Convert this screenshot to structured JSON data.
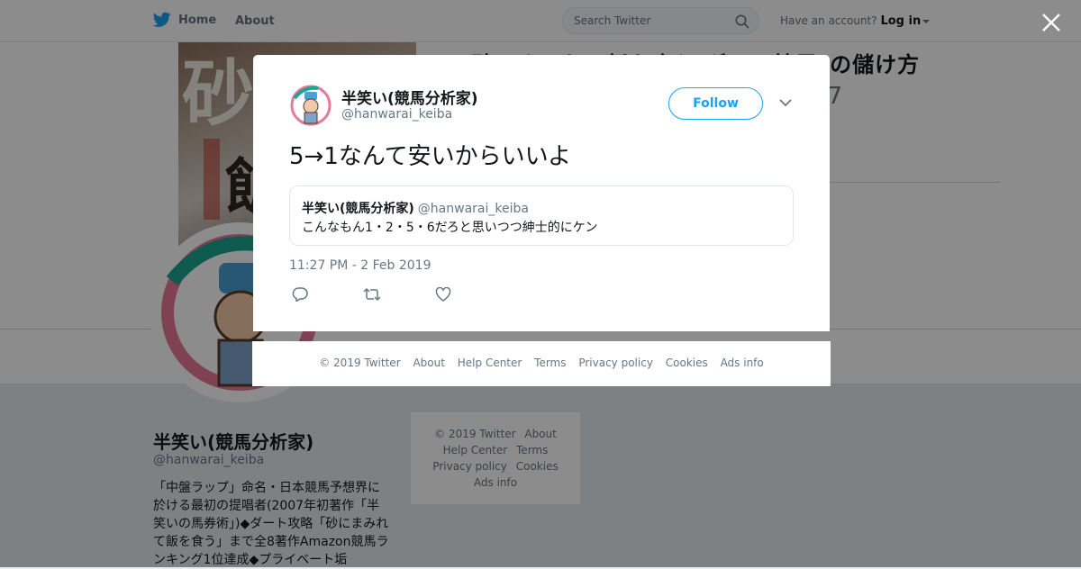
{
  "nav": {
    "home_label": "Home",
    "about_label": "About",
    "search_placeholder": "Search Twitter",
    "account_prompt": "Have an account?",
    "login_label": "Log in"
  },
  "background_profile": {
    "book_title": "砂にまみれて飯を食う ダート競馬\"の儲け方",
    "book_number": "17",
    "name": "半笑い(競馬分析家)",
    "handle": "@hanwarai_keiba",
    "bio": "「中盤ラップ」命名・日本競馬予想界に於ける最初の提唱者(2007年初著作「半笑いの馬券術」)◆ダート攻略「砂にまみれて飯を食う」まで全8著作Amazon競馬ランキング1位達成◆プライベート垢",
    "footer_links": [
      "© 2019 Twitter",
      "About",
      "Help Center",
      "Terms",
      "Privacy policy",
      "Cookies",
      "Ads info"
    ]
  },
  "tweet": {
    "author_name": "半笑い(競馬分析家)",
    "author_handle": "@hanwarai_keiba",
    "follow_label": "Follow",
    "text": "5→1なんて安いからいいよ",
    "quoted": {
      "author_name": "半笑い(競馬分析家)",
      "author_handle": "@hanwarai_keiba",
      "text": "こんなもん1・2・5・6だろと思いつつ紳士的にケン"
    },
    "timestamp": "11:27 PM - 2 Feb 2019"
  },
  "modal_footer": {
    "links": [
      "© 2019 Twitter",
      "About",
      "Help Center",
      "Terms",
      "Privacy policy",
      "Cookies",
      "Ads info"
    ]
  },
  "colors": {
    "accent": "#1da1f2",
    "text_primary": "#14171a",
    "text_secondary": "#657786"
  },
  "icons": {
    "logo": "twitter-bird-icon",
    "search": "search-icon",
    "close": "close-icon",
    "chevron": "chevron-down-icon",
    "reply": "reply-icon",
    "retweet": "retweet-icon",
    "like": "heart-icon"
  }
}
